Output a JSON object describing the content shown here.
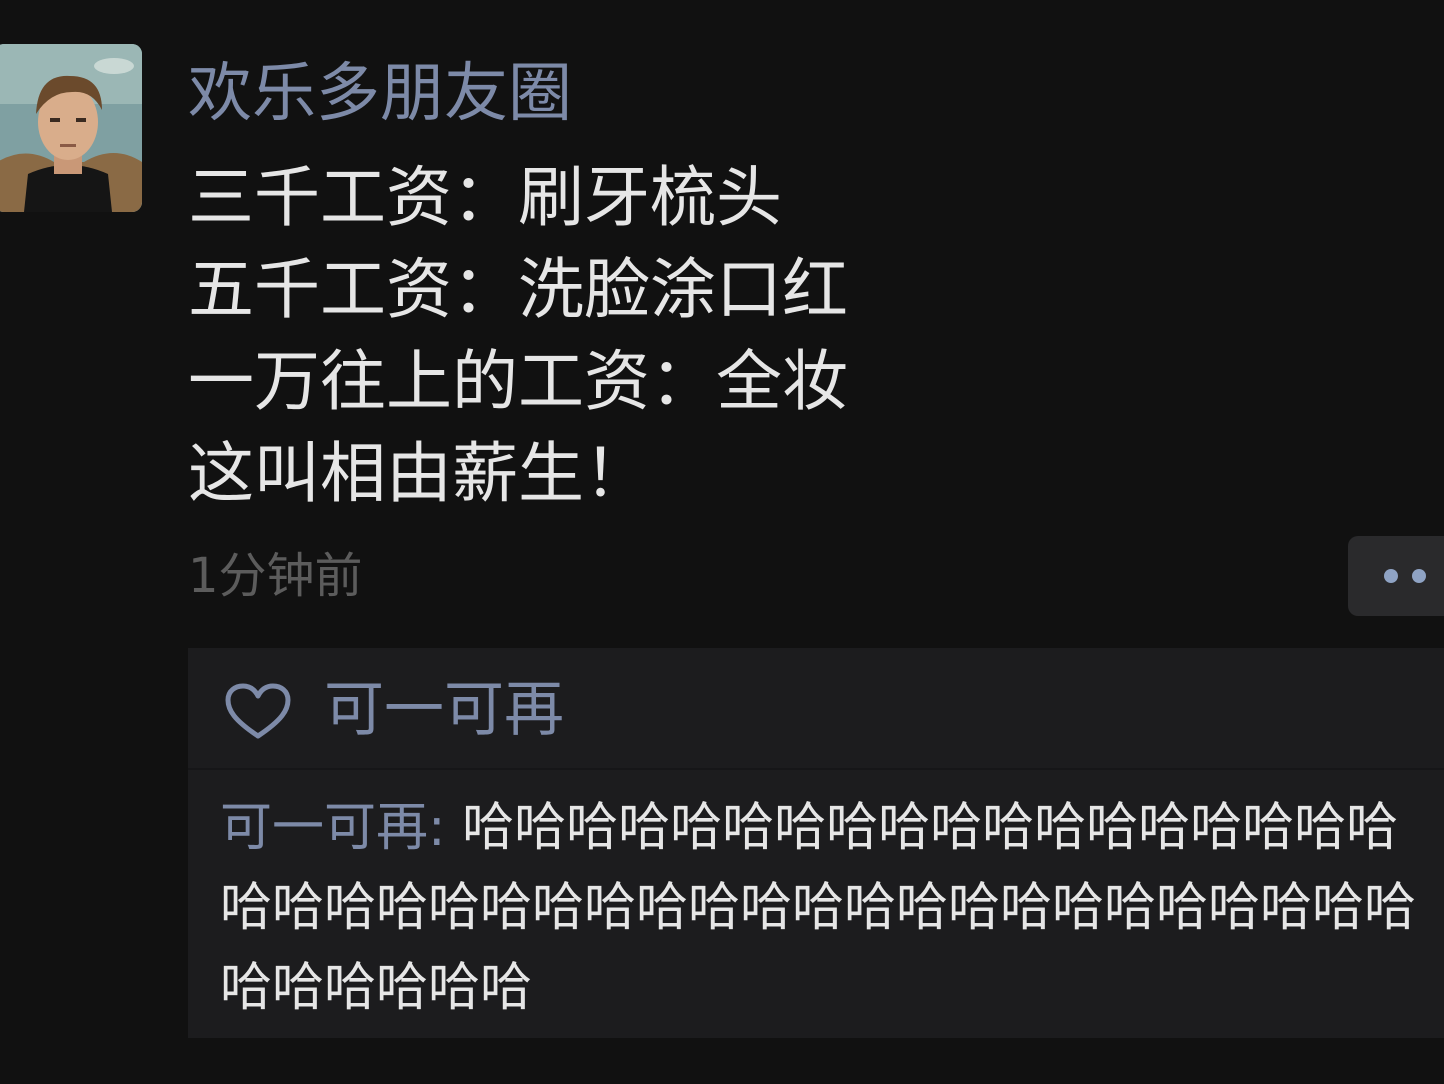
{
  "post": {
    "username": "欢乐多朋友圈",
    "lines": [
      "三千工资：刷牙梳头",
      "五千工资：洗脸涂口红",
      "一万往上的工资：全妆",
      "这叫相由薪生！"
    ],
    "timestamp": "1分钟前",
    "more_icon": "more-dots-icon"
  },
  "likes": {
    "icon": "heart-icon",
    "names": "可一可再"
  },
  "comment": {
    "author": "可一可再",
    "separator": ": ",
    "text": "哈哈哈哈哈哈哈哈哈哈哈哈哈哈哈哈哈哈哈哈哈哈哈哈哈哈哈哈哈哈哈哈哈哈哈哈哈哈哈哈哈哈哈哈哈哈哈"
  },
  "colors": {
    "background": "#111111",
    "name_link": "#7d8aa8",
    "body_text": "#e6e6e6",
    "timestamp": "#5c5c5c",
    "panel": "#1c1c1e"
  }
}
